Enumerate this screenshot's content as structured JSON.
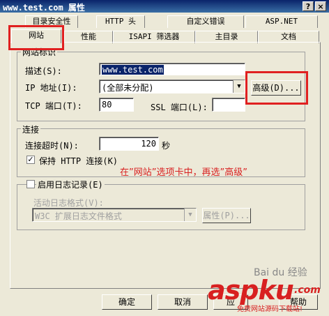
{
  "window": {
    "title": "www.test.com 属性",
    "help_button": "?",
    "close_button": "×"
  },
  "tabs_back": [
    "目录安全性",
    "HTTP 头",
    "自定义错误",
    "ASP.NET"
  ],
  "tabs_front": [
    "网站",
    "性能",
    "ISAPI 筛选器",
    "主目录",
    "文档"
  ],
  "site_id": {
    "legend": "网站标识",
    "description_label": "描述(S):",
    "description_value": "www.test.com",
    "ip_label": "IP 地址(I):",
    "ip_value": "(全部未分配)",
    "tcp_label": "TCP 端口(T):",
    "tcp_value": "80",
    "ssl_label": "SSL 端口(L):",
    "ssl_value": "",
    "advanced_button": "高级(D)..."
  },
  "connection": {
    "legend": "连接",
    "timeout_label": "连接超时(N):",
    "timeout_value": "120",
    "timeout_unit": "秒",
    "keepalive_label": "保持 HTTP 连接(K)",
    "keepalive_checked": "✓"
  },
  "logging": {
    "enable_label": "启用日志记录(E)",
    "format_label": "活动日志格式(V):",
    "format_value": "W3C 扩展日志文件格式",
    "properties_button": "属性(P)..."
  },
  "annotation": "在”网站”选项卡中，再选”高级”",
  "footer": {
    "ok_button": "确定",
    "cancel_button": "取消",
    "apply_partial": "应",
    "help_partial": "帮助"
  },
  "watermark": {
    "brand": "aspku",
    "domain_suffix": ".com",
    "subtitle": "免费网站源码下载站!",
    "baidu": "Bai du 经验"
  },
  "colors": {
    "accent_red": "#e02020",
    "titlebar": "#0a246a"
  }
}
